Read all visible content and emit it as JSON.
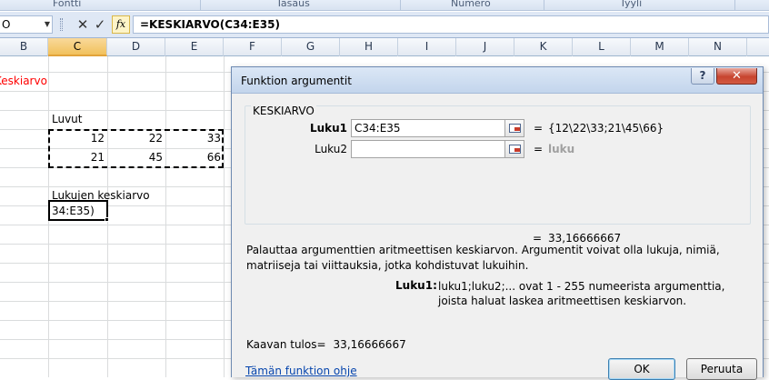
{
  "ribbon_groups": [
    "Fontti",
    "Tasaus",
    "Numero",
    "Tyyli"
  ],
  "name_box": "O",
  "formula_bar": {
    "cancel_symbol": "✕",
    "enter_symbol": "✓",
    "fx_label": "fx",
    "formula": "=KESKIARVO(C34:E35)"
  },
  "columns": [
    "B",
    "C",
    "D",
    "E",
    "F",
    "G",
    "H",
    "I",
    "J",
    "K",
    "L",
    "M",
    "N"
  ],
  "selected_column": "C",
  "sheet": {
    "title_text": "Keskiarvo",
    "luvut_label": "Luvut",
    "values_row1": [
      "12",
      "22",
      "33"
    ],
    "values_row2": [
      "21",
      "45",
      "66"
    ],
    "avg_label": "Lukujen keskiarvo",
    "active_cell_text": "34:E35)",
    "colors": {
      "title": "#ff0000"
    }
  },
  "dialog": {
    "title": "Funktion argumentit",
    "help_button": "?",
    "close_button": "✕",
    "function_name": "KESKIARVO",
    "arg1_label": "Luku1",
    "arg1_value": "C34:E35",
    "arg1_result": "{12\\22\\33;21\\45\\66}",
    "arg2_label": "Luku2",
    "arg2_value": "",
    "arg2_result": "luku",
    "equals": "=",
    "function_result": "33,16666667",
    "description": "Palauttaa argumenttien aritmeettisen keskiarvon. Argumentit voivat olla lukuja, nimiä, matriiseja tai viittauksia, jotka kohdistuvat lukuihin.",
    "arg_help_label": "Luku1:",
    "arg_help_text": "luku1;luku2;... ovat 1 - 255 numeerista argumenttia, joista haluat laskea aritmeettisen keskiarvon.",
    "formula_result_label": "Kaavan tulos=",
    "formula_result_value": "33,16666667",
    "help_link": "Tämän funktion ohje",
    "ok_button": "OK",
    "cancel_button": "Peruuta"
  }
}
